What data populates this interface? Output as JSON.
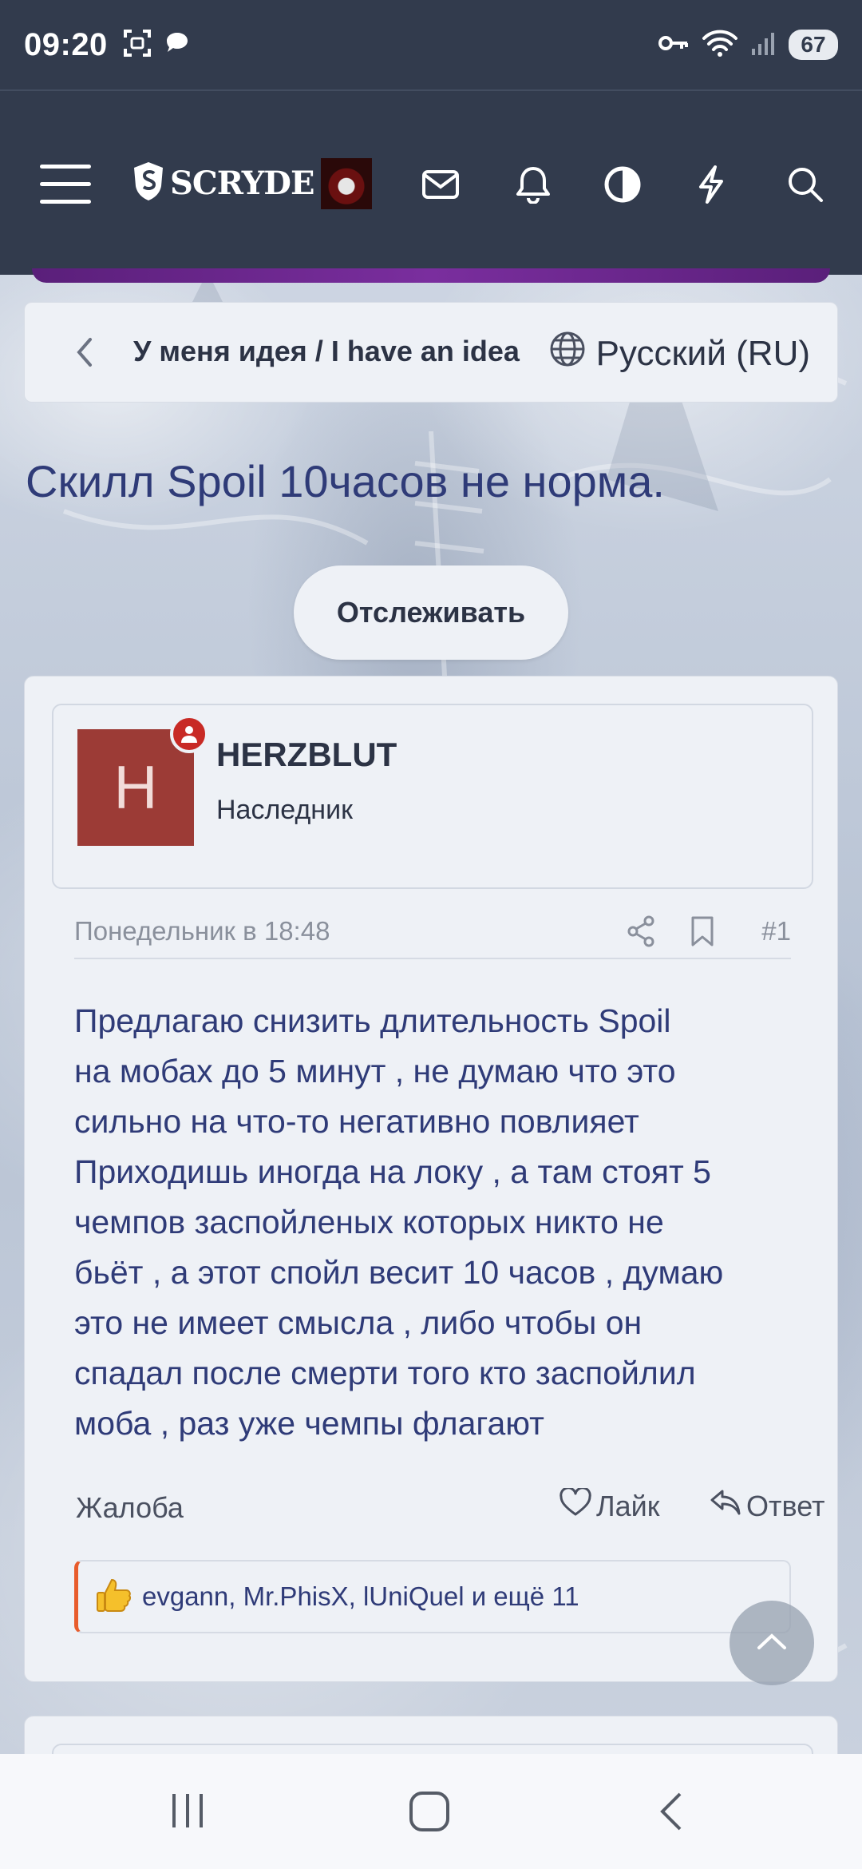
{
  "status_bar": {
    "time": "09:20",
    "battery": "67",
    "icons": [
      "screenshot-icon",
      "chat-bubble-icon",
      "vpn-key-icon",
      "wifi-icon",
      "signal-icon"
    ]
  },
  "header": {
    "logo_text": "SCRYDE",
    "icons": [
      "menu-icon",
      "mail-icon",
      "bell-icon",
      "contrast-icon",
      "lightning-icon",
      "search-icon"
    ]
  },
  "breadcrumb": {
    "label": "У меня идея / I have an idea",
    "language": "Русский (RU)"
  },
  "thread": {
    "title": "Скилл Spoil 10часов не норма.",
    "follow_label": "Отслеживать"
  },
  "post": {
    "author": {
      "name": "HERZBLUT",
      "title": "Наследник",
      "avatar_letter": "H",
      "avatar_color": "#9c3b36"
    },
    "date": "Понедельник в 18:48",
    "number": "#1",
    "body_lines": [
      "Предлагаю снизить длительность Spoil",
      "на мобах до 5 минут , не думаю что это",
      "сильно на что-то негативно повлияет",
      "Приходишь иногда на локу , а там стоят 5",
      "чемпов заспойленых которых никто не",
      "бьёт , а этот спойл весит 10 часов , думаю",
      "это не имеет смысла , либо чтобы он",
      "спадал после смерти того кто заспойлил",
      "моба , раз уже чемпы флагают"
    ],
    "actions": {
      "report": "Жалоба",
      "like": "Лайк",
      "reply": "Ответ"
    },
    "reactions_text": "evgann, Mr.PhisX, lUniQuel и ещё 11"
  },
  "colors": {
    "header_bg": "#323b4d",
    "card_bg": "#eef1f6",
    "title_text": "#2f3b78",
    "reaction_accent": "#e85c2c",
    "online_badge": "#c82a25"
  }
}
